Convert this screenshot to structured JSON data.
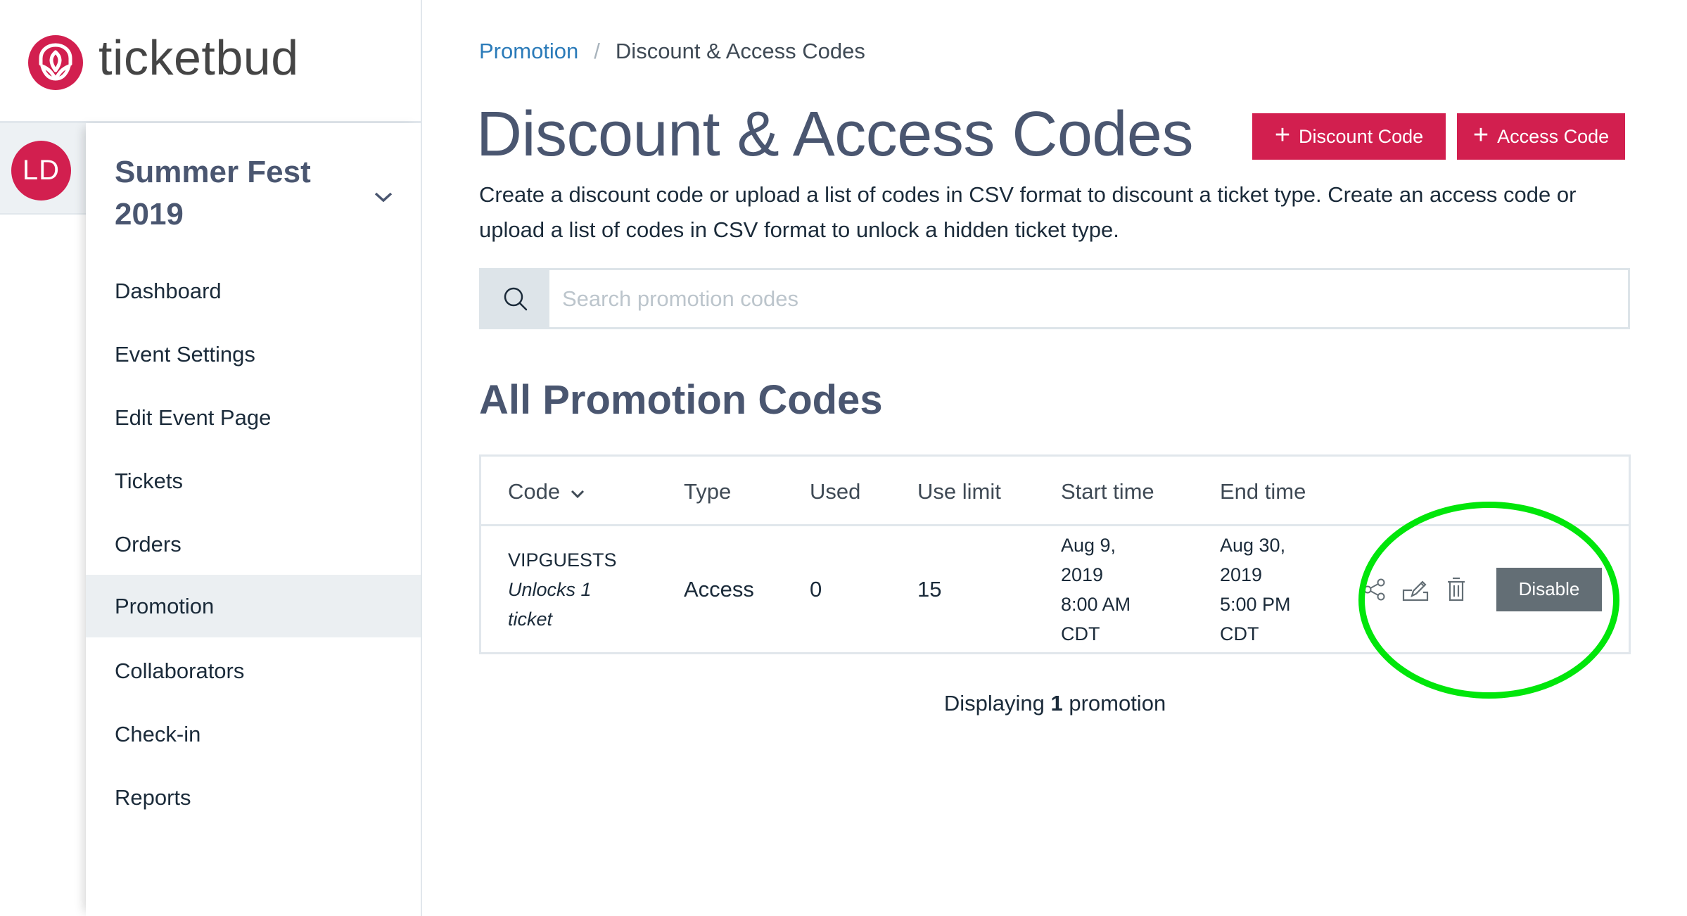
{
  "app": {
    "brand_name": "ticketbud",
    "brand_color": "#d21f4f",
    "highlight_color": "#00e60a"
  },
  "user": {
    "initials": "LD"
  },
  "sidebar": {
    "event_title": "Summer Fest 2019",
    "event_chevron_icon": "chevron-down-icon",
    "items": [
      {
        "label": "Dashboard",
        "active": false
      },
      {
        "label": "Event Settings",
        "active": false
      },
      {
        "label": "Edit Event Page",
        "active": false
      },
      {
        "label": "Tickets",
        "active": false
      },
      {
        "label": "Orders",
        "active": false
      },
      {
        "label": "Promotion",
        "active": true
      },
      {
        "label": "Collaborators",
        "active": false
      },
      {
        "label": "Check-in",
        "active": false
      },
      {
        "label": "Reports",
        "active": false
      }
    ]
  },
  "breadcrumb": {
    "parent": "Promotion",
    "separator": "/",
    "current": "Discount & Access Codes"
  },
  "header": {
    "title": "Discount & Access Codes",
    "discount_button": {
      "icon": "plus",
      "label": "Discount Code"
    },
    "access_button": {
      "icon": "plus",
      "label": "Access Code"
    },
    "description": "Create a discount code or upload a list of codes in CSV format to discount a ticket type. Create an access code or upload a list of codes in CSV format to unlock a hidden ticket type."
  },
  "search": {
    "icon": "search-icon",
    "placeholder": "Search promotion codes",
    "value": ""
  },
  "section": {
    "title": "All Promotion Codes"
  },
  "table": {
    "columns": [
      {
        "key": "code",
        "label": "Code",
        "sortable": true
      },
      {
        "key": "type",
        "label": "Type"
      },
      {
        "key": "used",
        "label": "Used"
      },
      {
        "key": "use_limit",
        "label": "Use limit"
      },
      {
        "key": "start_time",
        "label": "Start time"
      },
      {
        "key": "end_time",
        "label": "End time"
      }
    ],
    "rows": [
      {
        "code": "VIPGUESTS",
        "description": "Unlocks 1 ticket",
        "type": "Access",
        "used": "0",
        "use_limit": "15",
        "start_time": {
          "date": "Aug 9,",
          "year": "2019",
          "time": "8:00 AM",
          "tz": "CDT"
        },
        "end_time": {
          "date": "Aug 30,",
          "year": "2019",
          "time": "5:00 PM",
          "tz": "CDT"
        },
        "actions": {
          "share_icon": "share-icon",
          "edit_icon": "edit-icon",
          "delete_icon": "trash-icon",
          "disable_label": "Disable"
        }
      }
    ]
  },
  "footer": {
    "prefix": "Displaying",
    "count": "1",
    "suffix": "promotion"
  }
}
